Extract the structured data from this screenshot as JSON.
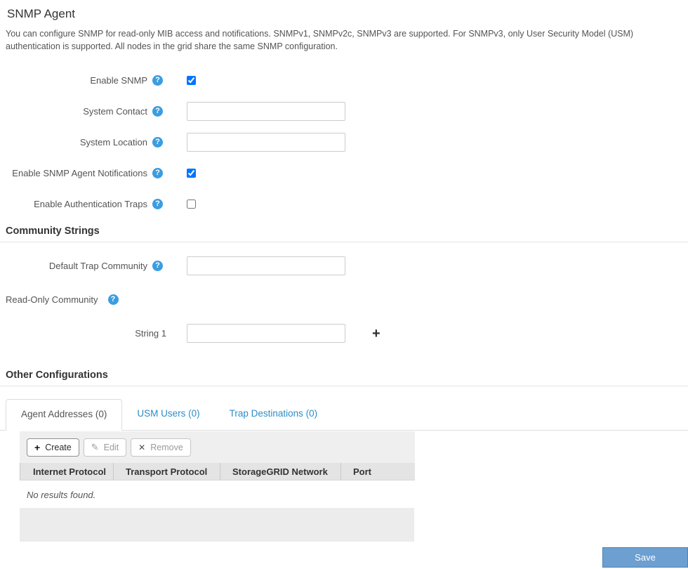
{
  "page": {
    "title": "SNMP Agent",
    "description": "You can configure SNMP for read-only MIB access and notifications. SNMPv1, SNMPv2c, SNMPv3 are supported. For SNMPv3, only User Security Model (USM) authentication is supported. All nodes in the grid share the same SNMP configuration."
  },
  "form": {
    "fields": [
      {
        "label": "Enable SNMP",
        "type": "checkbox",
        "checked": true
      },
      {
        "label": "System Contact",
        "type": "text",
        "value": ""
      },
      {
        "label": "System Location",
        "type": "text",
        "value": ""
      },
      {
        "label": "Enable SNMP Agent Notifications",
        "type": "checkbox",
        "checked": true
      },
      {
        "label": "Enable Authentication Traps",
        "type": "checkbox",
        "checked": false
      }
    ]
  },
  "community": {
    "title": "Community Strings",
    "default_trap": {
      "label": "Default Trap Community",
      "value": ""
    },
    "read_only": {
      "label": "Read-Only Community"
    },
    "string1": {
      "label": "String 1",
      "value": ""
    },
    "add_icon": "plus-icon"
  },
  "other": {
    "title": "Other Configurations",
    "tabs": [
      {
        "label": "Agent Addresses (0)",
        "active": true
      },
      {
        "label": "USM Users (0)",
        "active": false
      },
      {
        "label": "Trap Destinations (0)",
        "active": false
      }
    ],
    "toolbar": {
      "create": "Create",
      "edit": "Edit",
      "remove": "Remove"
    },
    "table": {
      "headers": [
        "Internet Protocol",
        "Transport Protocol",
        "StorageGRID Network",
        "Port"
      ],
      "empty_text": "No results found."
    }
  },
  "save_label": "Save",
  "colors": {
    "help_icon": "#3b9de0",
    "tab_link": "#2b8dc7",
    "save_bg": "#6d9fd0",
    "save_border": "#5084b4"
  }
}
